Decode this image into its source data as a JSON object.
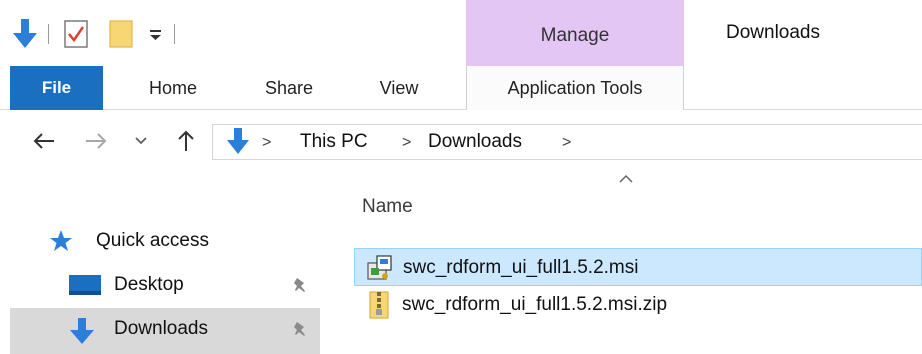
{
  "quick_access_toolbar": {
    "icons": [
      "download-arrow-icon",
      "properties-icon",
      "new-folder-icon",
      "customize-dropdown-icon"
    ]
  },
  "ribbon": {
    "contextual_group": "Manage",
    "tabs": {
      "file": "File",
      "home": "Home",
      "share": "Share",
      "view": "View",
      "application_tools": "Application Tools"
    }
  },
  "window": {
    "title": "Downloads"
  },
  "address_bar": {
    "breadcrumb": [
      "This PC",
      "Downloads"
    ],
    "separator": ">"
  },
  "navigation_pane": {
    "items": [
      {
        "label": "Quick access",
        "icon": "star-icon"
      },
      {
        "label": "Desktop",
        "icon": "desktop-icon",
        "pinned": true
      },
      {
        "label": "Downloads",
        "icon": "download-arrow-icon",
        "pinned": true,
        "selected": true
      }
    ]
  },
  "file_list": {
    "column_header": "Name",
    "sort": "ascending",
    "files": [
      {
        "name": "swc_rdform_ui_full1.5.2.msi",
        "icon": "msi-installer-icon",
        "selected": true
      },
      {
        "name": "swc_rdform_ui_full1.5.2.msi.zip",
        "icon": "zip-archive-icon",
        "selected": false
      }
    ]
  },
  "colors": {
    "accent_blue": "#1a6fc1",
    "manage_purple": "#e4c6f4",
    "selection_blue": "#cce8ff",
    "nav_selected_gray": "#d9d9d9"
  }
}
